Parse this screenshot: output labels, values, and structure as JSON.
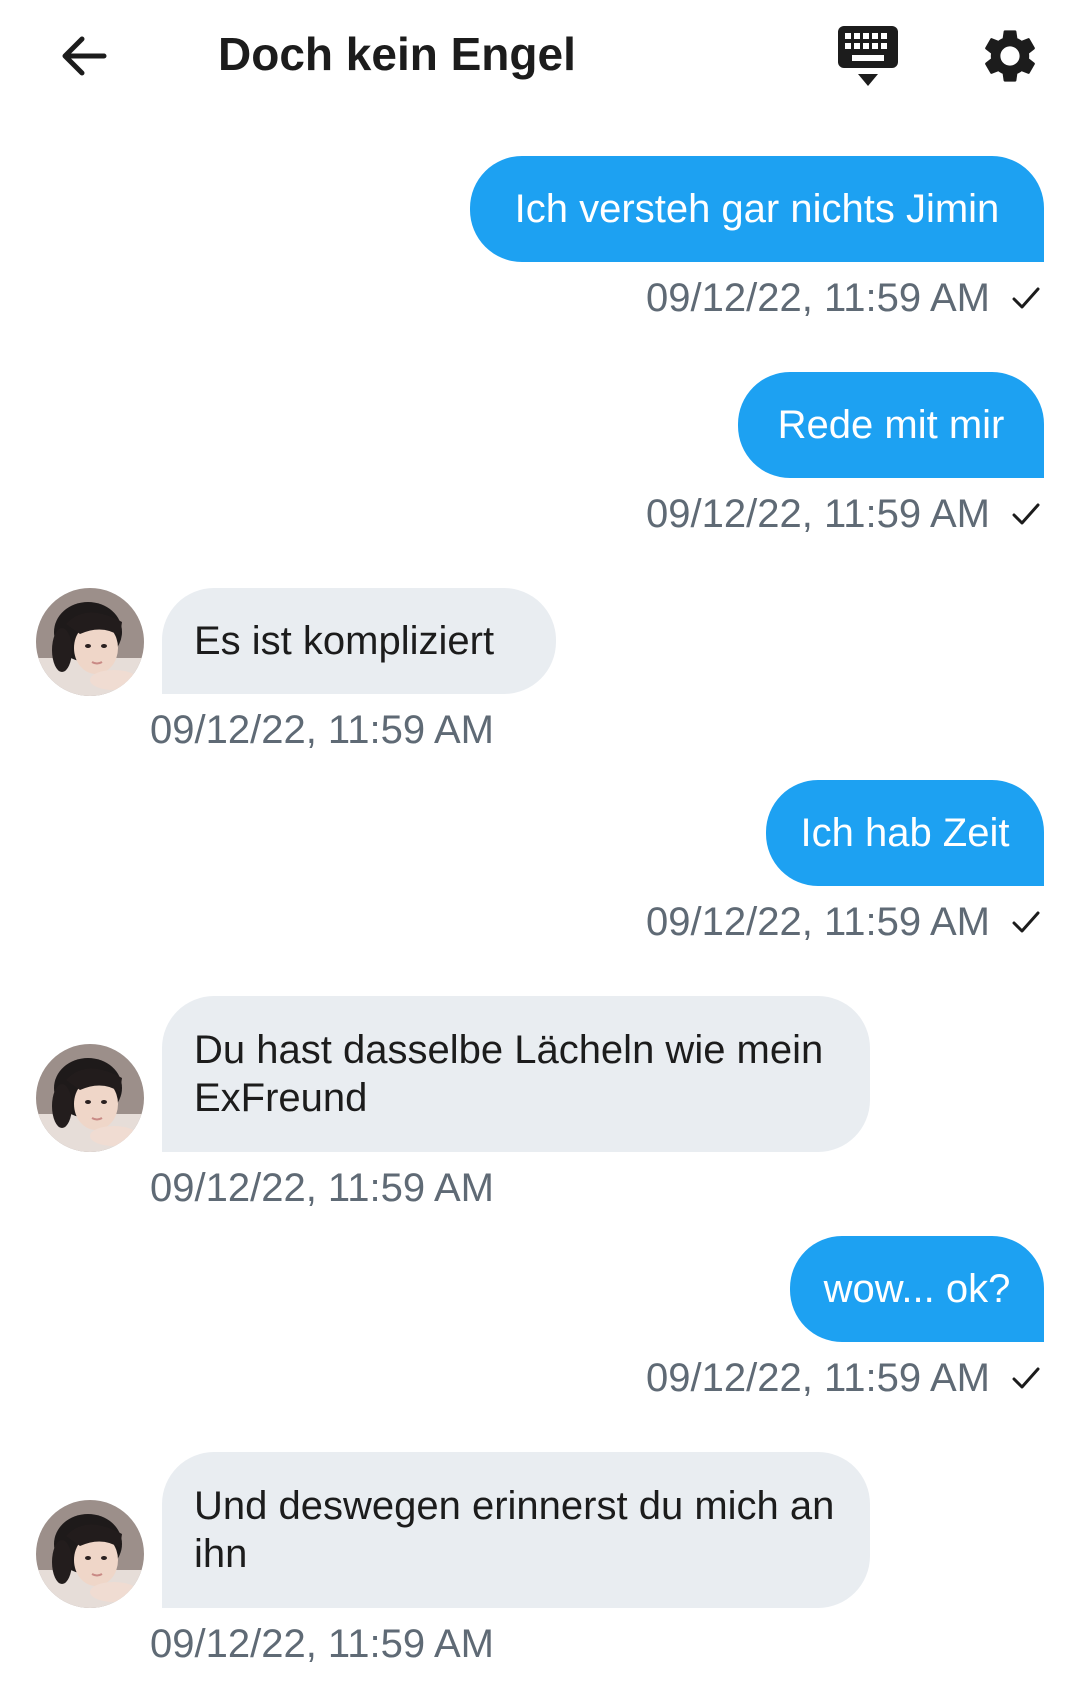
{
  "header": {
    "title": "Doch kein Engel",
    "back_icon": "arrow-left-icon",
    "keyboard_icon": "keyboard-hide-icon",
    "settings_icon": "gear-icon"
  },
  "colors": {
    "outgoing_bubble": "#1da1f2",
    "incoming_bubble": "#e9edf1",
    "timestamp": "#5f6a75"
  },
  "messages": [
    {
      "direction": "out",
      "text": "Ich versteh gar nichts Jimin",
      "time": "09/12/22, 11:59 AM",
      "status_icon": "check-icon"
    },
    {
      "direction": "out",
      "text": "Rede mit mir",
      "time": "09/12/22, 11:59 AM",
      "status_icon": "check-icon"
    },
    {
      "direction": "in",
      "text": "Es ist kompliziert",
      "time": "09/12/22, 11:59 AM",
      "avatar_icon": "avatar"
    },
    {
      "direction": "out",
      "text": "Ich hab Zeit",
      "time": "09/12/22, 11:59 AM",
      "status_icon": "check-icon"
    },
    {
      "direction": "in",
      "text": "Du hast dasselbe Lächeln wie mein ExFreund",
      "time": "09/12/22, 11:59 AM",
      "avatar_icon": "avatar"
    },
    {
      "direction": "out",
      "text": "wow... ok?",
      "time": "09/12/22, 11:59 AM",
      "status_icon": "check-icon"
    },
    {
      "direction": "in",
      "text": "Und deswegen erinnerst du mich an ihn",
      "time": "09/12/22, 11:59 AM",
      "avatar_icon": "avatar"
    }
  ]
}
